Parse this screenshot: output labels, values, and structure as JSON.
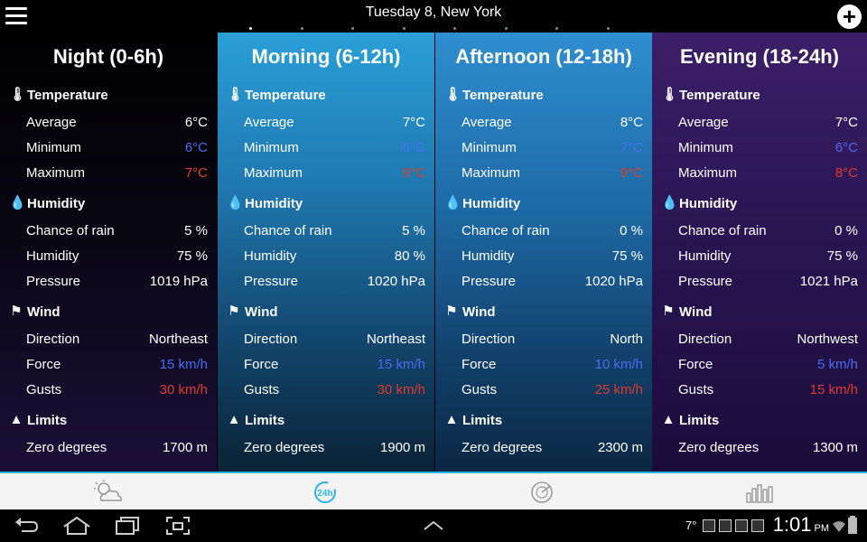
{
  "header": {
    "title": "Tuesday 8, New York",
    "page_count": 8,
    "active_page": 0
  },
  "labels": {
    "temperature": "Temperature",
    "average": "Average",
    "minimum": "Minimum",
    "maximum": "Maximum",
    "humidity_section": "Humidity",
    "chance_of_rain": "Chance of rain",
    "humidity": "Humidity",
    "pressure": "Pressure",
    "wind": "Wind",
    "direction": "Direction",
    "force": "Force",
    "gusts": "Gusts",
    "limits": "Limits",
    "zero_degrees": "Zero degrees"
  },
  "periods": [
    {
      "name": "Night (0-6h)",
      "avg": "6°C",
      "min": "6°C",
      "max": "7°C",
      "rain": "5 %",
      "humidity": "75 %",
      "pressure": "1019 hPa",
      "direction": "Northeast",
      "force": "15 km/h",
      "gusts": "30 km/h",
      "zero": "1700 m"
    },
    {
      "name": "Morning (6-12h)",
      "avg": "7°C",
      "min": "6°C",
      "max": "9°C",
      "rain": "5 %",
      "humidity": "80 %",
      "pressure": "1020 hPa",
      "direction": "Northeast",
      "force": "15 km/h",
      "gusts": "30 km/h",
      "zero": "1900 m"
    },
    {
      "name": "Afternoon (12-18h)",
      "avg": "8°C",
      "min": "7°C",
      "max": "9°C",
      "rain": "0 %",
      "humidity": "75 %",
      "pressure": "1020 hPa",
      "direction": "North",
      "force": "10 km/h",
      "gusts": "25 km/h",
      "zero": "2300 m"
    },
    {
      "name": "Evening (18-24h)",
      "avg": "7°C",
      "min": "6°C",
      "max": "8°C",
      "rain": "0 %",
      "humidity": "75 %",
      "pressure": "1021 hPa",
      "direction": "Northwest",
      "force": "5 km/h",
      "gusts": "15 km/h",
      "zero": "1300 m"
    }
  ],
  "colors": {
    "accent": "#27b5e6",
    "min_value": "#4a6cf0",
    "max_value": "#e23a2d"
  },
  "bottom_nav": [
    {
      "icon": "cloud-sun-icon",
      "active": false
    },
    {
      "icon": "24h-icon",
      "active": true
    },
    {
      "icon": "radar-icon",
      "active": false
    },
    {
      "icon": "bar-chart-icon",
      "active": false
    }
  ],
  "status_bar": {
    "temperature": "7°",
    "time": "1:01",
    "ampm": "PM"
  }
}
